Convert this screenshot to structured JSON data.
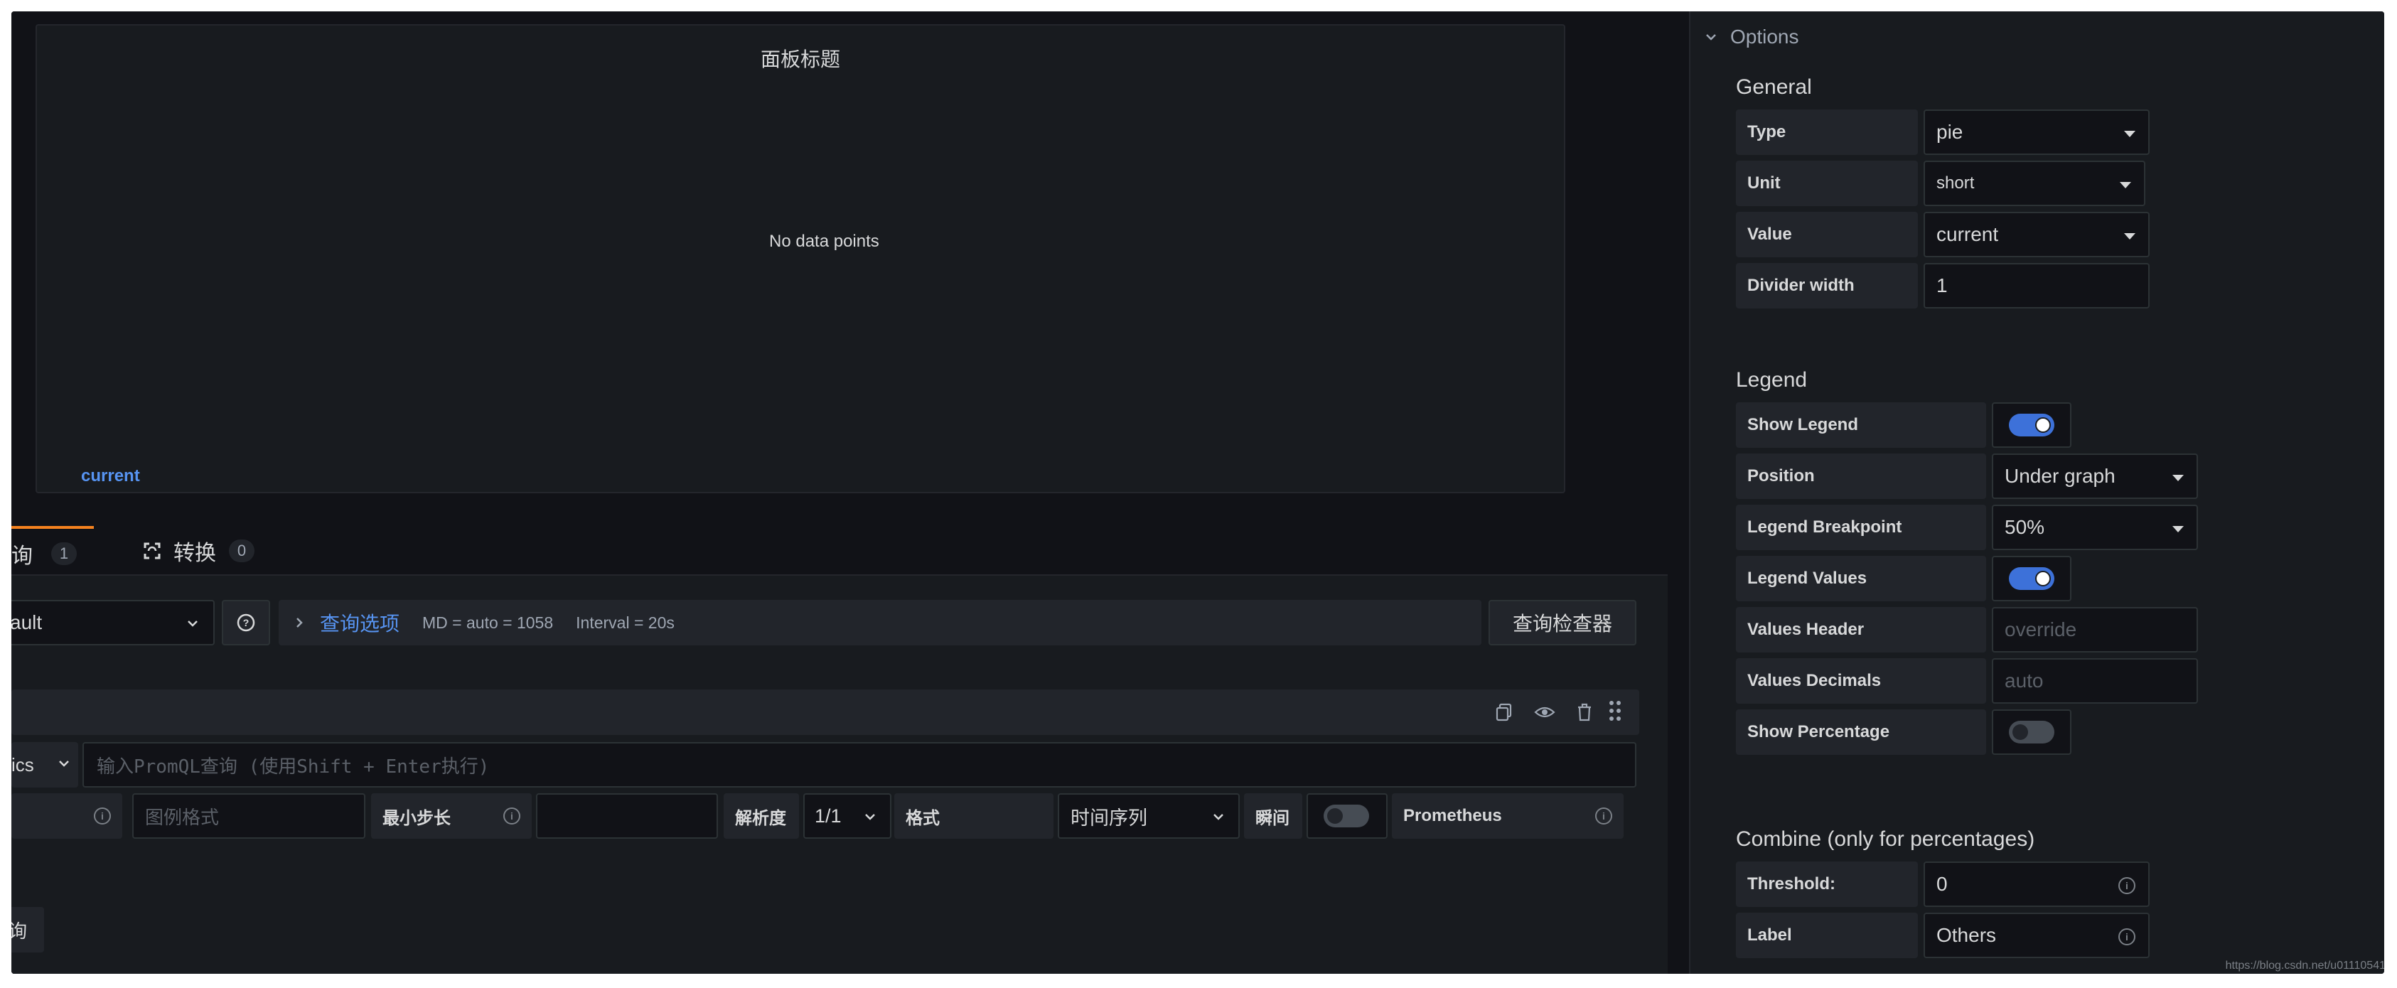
{
  "panel": {
    "title": "面板标题",
    "no_data": "No data points",
    "legend_item": "current"
  },
  "tabs": [
    {
      "label": "询",
      "count": "1"
    },
    {
      "label": "转换",
      "count": "0"
    }
  ],
  "query_bar": {
    "datasource": "ault",
    "query_options_label": "查询选项",
    "md_info": "MD = auto = 1058",
    "interval_info": "Interval = 20s",
    "inspector_button": "查询检查器"
  },
  "query_row": {
    "metrics_label": "ics",
    "promql_placeholder": "输入PromQL查询 (使用Shift + Enter执行)",
    "legend_placeholder": "图例格式",
    "min_step_label": "最小步长",
    "resolution_label": "解析度",
    "resolution_value": "1/1",
    "format_label": "格式",
    "format_value": "时间序列",
    "instant_label": "瞬间",
    "source_label": "Prometheus",
    "add_query_fragment": "询"
  },
  "options": {
    "header": "Options",
    "general": {
      "title": "General",
      "type_label": "Type",
      "type_value": "pie",
      "unit_label": "Unit",
      "unit_value": "short",
      "value_label": "Value",
      "value_value": "current",
      "divider_label": "Divider width",
      "divider_value": "1"
    },
    "legend": {
      "title": "Legend",
      "show_legend_label": "Show Legend",
      "show_legend": true,
      "position_label": "Position",
      "position_value": "Under graph",
      "breakpoint_label": "Legend Breakpoint",
      "breakpoint_value": "50%",
      "values_label": "Legend Values",
      "legend_values": true,
      "values_header_label": "Values Header",
      "values_header_placeholder": "override",
      "values_decimals_label": "Values Decimals",
      "values_decimals_placeholder": "auto",
      "show_percentage_label": "Show Percentage",
      "show_percentage": false
    },
    "combine": {
      "title": "Combine (only for percentages)",
      "threshold_label": "Threshold:",
      "threshold_value": "0",
      "label_label": "Label",
      "label_value": "Others"
    }
  },
  "watermark": "https://blog.csdn.net/u01110541",
  "colors": {
    "accent_blue": "#5794f2",
    "toggle_on": "#3d71d9",
    "tab_active": "#f5821f"
  }
}
